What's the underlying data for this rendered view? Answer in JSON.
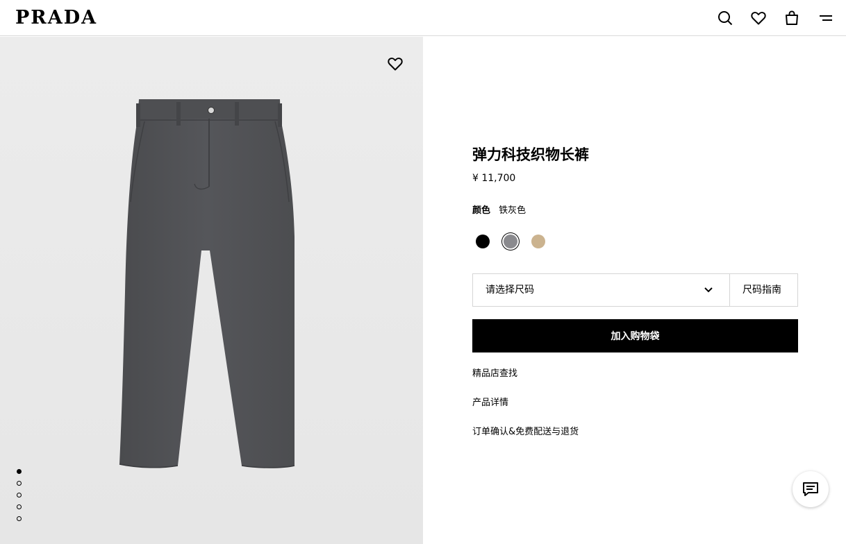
{
  "header": {
    "brand": "PRADA",
    "icons": [
      "search-icon",
      "heart-icon",
      "shopping-bag-icon",
      "menu-icon"
    ]
  },
  "gallery": {
    "image": "charcoal-gray-trousers",
    "slide_count": 5,
    "active_slide": 1
  },
  "product": {
    "title": "弹力科技织物长裤",
    "price": "¥ 11,700",
    "color_label": "颜色",
    "color_value": "铁灰色",
    "swatches": [
      {
        "color": "#000000",
        "selected": false
      },
      {
        "color": "#8a8a8e",
        "selected": true
      },
      {
        "color": "#cbb38f",
        "selected": false
      }
    ]
  },
  "size": {
    "placeholder": "请选择尺码",
    "guide_label": "尺码指南"
  },
  "actions": {
    "add_to_bag": "加入购物袋"
  },
  "links": [
    "精品店查找",
    "产品详情",
    "订单确认&免费配送与退货"
  ],
  "chat": {
    "icon": "chat-icon"
  }
}
